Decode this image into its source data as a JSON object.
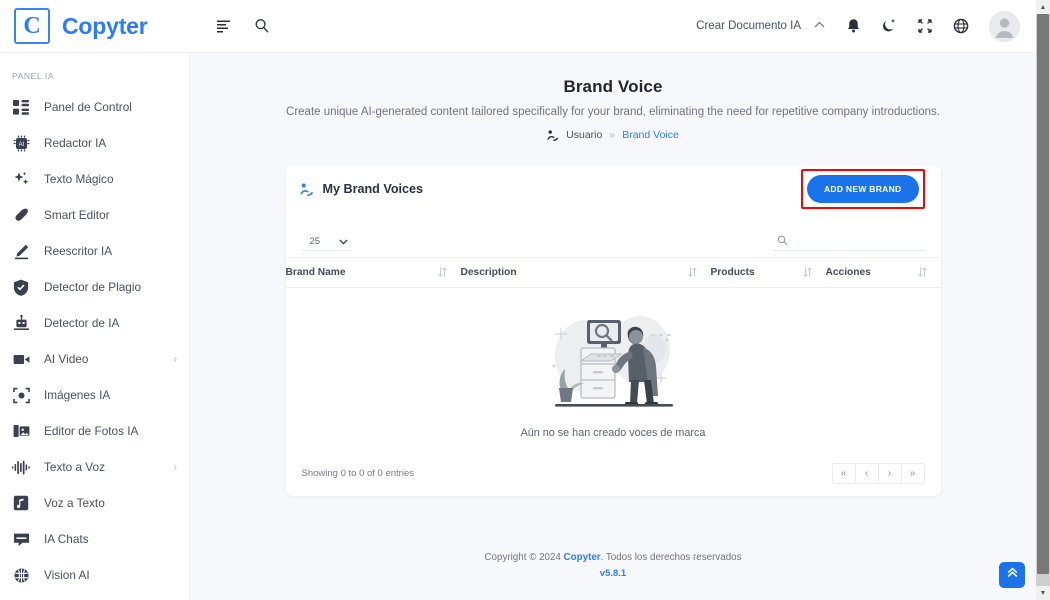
{
  "app": {
    "logo_letter": "C",
    "brand_name": "Copyter"
  },
  "header": {
    "menu_icon": "align-left-icon",
    "search_icon": "search-icon",
    "create_document_label": "Crear Documento IA",
    "chevron_up": "⌃",
    "bell_icon": "bell-icon",
    "theme_icon": "moon-icon",
    "fullscreen_icon": "compress-icon",
    "language_icon": "globe-icon",
    "avatar_icon": "user-avatar"
  },
  "sidebar": {
    "section_title": "PANEL IA",
    "items": [
      {
        "label": "Panel de Control",
        "icon": "dashboard-icon",
        "has_chevron": false
      },
      {
        "label": "Redactor IA",
        "icon": "chip-ai-icon",
        "has_chevron": false
      },
      {
        "label": "Texto Mágico",
        "icon": "sparkles-icon",
        "has_chevron": false
      },
      {
        "label": "Smart Editor",
        "icon": "pen-icon",
        "has_chevron": false
      },
      {
        "label": "Reescritor IA",
        "icon": "pencil-icon",
        "has_chevron": false
      },
      {
        "label": "Detector de Plagio",
        "icon": "shield-check-icon",
        "has_chevron": false
      },
      {
        "label": "Detector de IA",
        "icon": "robot-scan-icon",
        "has_chevron": false
      },
      {
        "label": "AI Video",
        "icon": "video-camera-icon",
        "has_chevron": true
      },
      {
        "label": "Imágenes IA",
        "icon": "image-frame-icon",
        "has_chevron": false
      },
      {
        "label": "Editor de Fotos IA",
        "icon": "photo-edit-icon",
        "has_chevron": false
      },
      {
        "label": "Texto a Voz",
        "icon": "waveform-icon",
        "has_chevron": true
      },
      {
        "label": "Voz a Texto",
        "icon": "music-note-icon",
        "has_chevron": false
      },
      {
        "label": "IA Chats",
        "icon": "chat-icon",
        "has_chevron": false
      },
      {
        "label": "Vision AI",
        "icon": "brain-icon",
        "has_chevron": false
      }
    ],
    "chevron_glyph": "›"
  },
  "page": {
    "title": "Brand Voice",
    "subtitle": "Create unique AI-generated content tailored specifically for your brand, eliminating the need for repetitive company introductions.",
    "breadcrumb": {
      "icon": "brand-voice-icon",
      "root": "Usuario",
      "separator": "»",
      "current": "Brand Voice"
    }
  },
  "card": {
    "icon": "brand-voice-icon",
    "title": "My Brand Voices",
    "add_button_label": "ADD NEW BRAND",
    "highlight_color": "#ff0000",
    "accent_color": "#1a73e8",
    "page_length_value": "25",
    "page_length_chevron": "⌄",
    "search_icon": "search-icon",
    "search_placeholder": "",
    "search_value": "",
    "columns": [
      {
        "label": "Brand Name",
        "sort_icon": "sort-icon"
      },
      {
        "label": "Description",
        "sort_icon": "sort-icon"
      },
      {
        "label": "Products",
        "sort_icon": "sort-icon"
      },
      {
        "label": "Acciones",
        "sort_icon": "sort-icon"
      }
    ],
    "rows": [],
    "empty_illustration": "no-data-illustration",
    "empty_text": "Aún no se han creado voces de marca",
    "showing_text": "Showing 0 to 0 of 0 entries",
    "pagination": [
      {
        "label": "«",
        "name": "first-page"
      },
      {
        "label": "‹",
        "name": "prev-page"
      },
      {
        "label": "›",
        "name": "next-page"
      },
      {
        "label": "»",
        "name": "last-page"
      }
    ]
  },
  "footer": {
    "copyright_prefix": "Copyright © 2024 ",
    "copyright_brand": "Copyter",
    "copyright_suffix": ". Todos los derechos reservados",
    "version": "v5.8.1"
  },
  "misc": {
    "to_top_icon": "chevron-double-up-icon",
    "scrollbar_up": "▲",
    "scrollbar_down": "▼"
  }
}
